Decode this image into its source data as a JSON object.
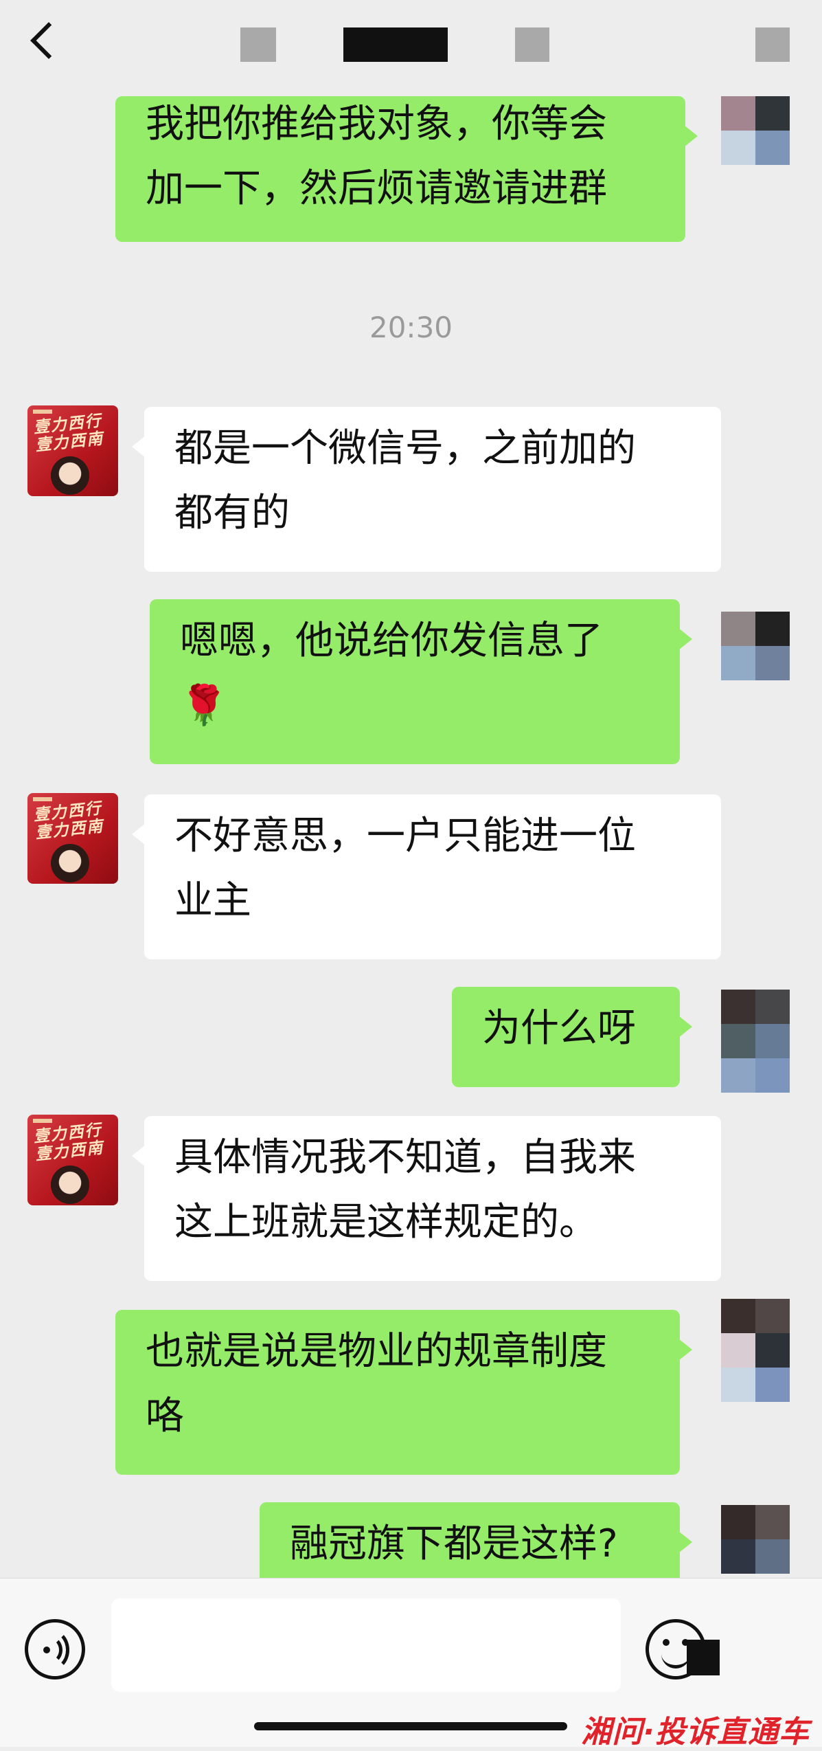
{
  "header": {
    "back_icon": "chevron-left-icon"
  },
  "messages": [
    {
      "side": "me",
      "lines": [
        "我把你推给我对象，你等会",
        "加一下，然后烦请邀请进群"
      ]
    },
    {
      "type": "time",
      "text": "20:30"
    },
    {
      "side": "other",
      "lines": [
        "都是一个微信号，之前加的",
        "都有的"
      ]
    },
    {
      "side": "me",
      "lines": [
        "嗯嗯，他说给你发信息了",
        "🌹"
      ]
    },
    {
      "side": "other",
      "lines": [
        "不好意思，一户只能进一位",
        "业主"
      ]
    },
    {
      "side": "me",
      "lines": [
        "为什么呀"
      ]
    },
    {
      "side": "other",
      "lines": [
        "具体情况我不知道，自我来",
        "这上班就是这样规定的。"
      ]
    },
    {
      "side": "me",
      "lines": [
        "也就是说是物业的规章制度",
        "咯"
      ]
    },
    {
      "side": "me",
      "lines": [
        "融冠旗下都是这样?"
      ]
    }
  ],
  "input_bar": {
    "voice_icon": "voice-icon",
    "emoji_icon": "emoji-icon",
    "input_value": ""
  },
  "watermark": "湘问·投诉直通车",
  "colors": {
    "background": "#ededed",
    "my_bubble": "#95ec69",
    "other_bubble": "#ffffff",
    "watermark": "#e0222b"
  }
}
